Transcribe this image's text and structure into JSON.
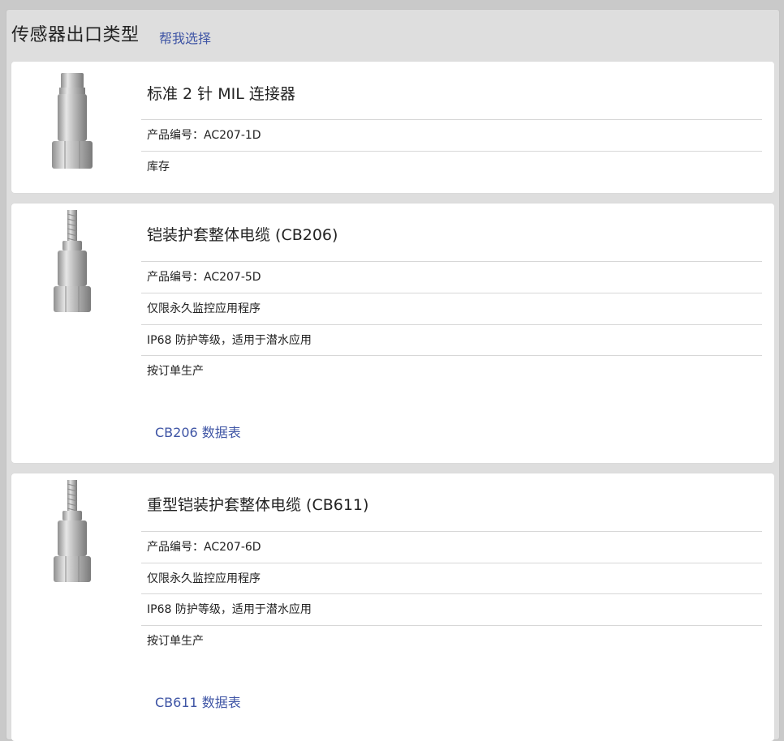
{
  "header": {
    "title": "传感器出口类型",
    "help_link": "帮我选择"
  },
  "products": [
    {
      "name": "标准 2 针 MIL 连接器",
      "thumb_icon": "mil-connector-sensor-icon",
      "rows": [
        "产品编号：AC207-1D",
        "库存"
      ],
      "datasheet": ""
    },
    {
      "name": "铠装护套整体电缆 (CB206)",
      "thumb_icon": "armored-cable-sensor-icon",
      "rows": [
        "产品编号：AC207-5D",
        "仅限永久监控应用程序",
        "IP68 防护等级，适用于潜水应用",
        "按订单生产"
      ],
      "datasheet": "CB206 数据表"
    },
    {
      "name": "重型铠装护套整体电缆 (CB611)",
      "thumb_icon": "heavy-armored-cable-sensor-icon",
      "rows": [
        "产品编号：AC207-6D",
        "仅限永久监控应用程序",
        "IP68 防护等级，适用于潜水应用",
        "按订单生产"
      ],
      "datasheet": "CB611 数据表"
    }
  ],
  "colors": {
    "link": "#3f55a5",
    "panel": "#dedede",
    "card": "#ffffff"
  }
}
